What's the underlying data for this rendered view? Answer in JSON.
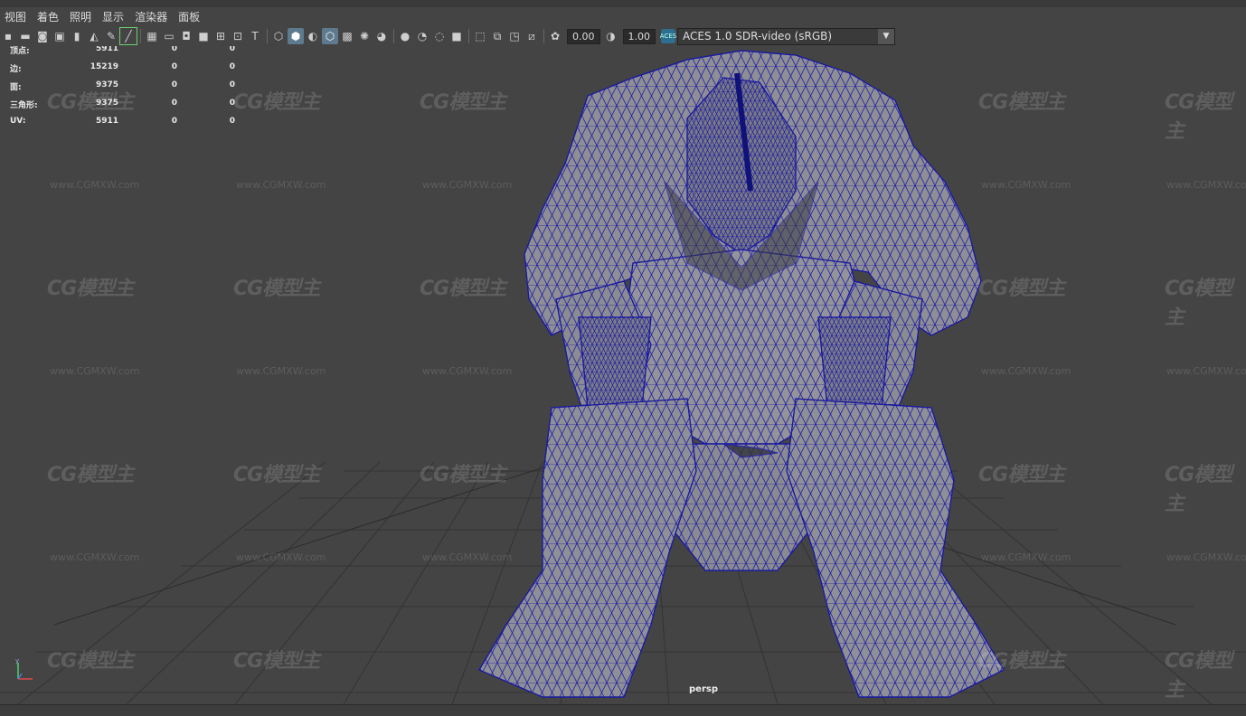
{
  "menu": {
    "items": [
      "视图",
      "着色",
      "照明",
      "显示",
      "渲染器",
      "面板"
    ]
  },
  "toolbar": {
    "exposure_value": "0.00",
    "gamma_value": "1.00",
    "colorspace": "ACES 1.0 SDR-video (sRGB)",
    "aces_badge": "ACES"
  },
  "hud": {
    "rows": [
      {
        "label": "顶点:",
        "v1": "5911",
        "v2": "0",
        "v3": "0"
      },
      {
        "label": "边:",
        "v1": "15219",
        "v2": "0",
        "v3": "0"
      },
      {
        "label": "面:",
        "v1": "9375",
        "v2": "0",
        "v3": "0"
      },
      {
        "label": "三角形:",
        "v1": "9375",
        "v2": "0",
        "v3": "0"
      },
      {
        "label": "UV:",
        "v1": "5911",
        "v2": "0",
        "v3": "0"
      }
    ]
  },
  "viewport": {
    "camera": "persp",
    "watermark": "CG模型主",
    "watermark_url": "www.CGMXW.com",
    "wire_color": "#1a1aa0",
    "mesh_color": "#8f8f95"
  }
}
